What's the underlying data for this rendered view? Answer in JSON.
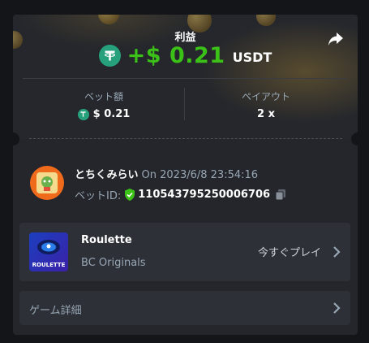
{
  "profit": {
    "label": "利益",
    "amount": "+$ 0.21",
    "currency": "USDT"
  },
  "bet_amount": {
    "label": "ベット額",
    "value": "$ 0.21"
  },
  "payout": {
    "label": "ペイアウト",
    "value": "2 x"
  },
  "user": {
    "name": "とちくみらい",
    "timestamp": "On 2023/6/8 23:54:16",
    "bet_id_label": "ベットID:",
    "bet_id": "110543795250006706"
  },
  "game": {
    "title": "Roulette",
    "provider": "BC Originals",
    "thumbnail_text": "ROULETTE",
    "play_label": "今すぐプレイ"
  },
  "details": {
    "label": "ゲーム詳細"
  },
  "colors": {
    "profit_green": "#3bc117",
    "tether_green": "#26a17b",
    "card_bg": "#24262b",
    "page_bg": "#141518"
  },
  "icons": [
    "tether-icon",
    "share-icon",
    "shield-check-icon",
    "copy-icon",
    "chevron-right-icon"
  ]
}
